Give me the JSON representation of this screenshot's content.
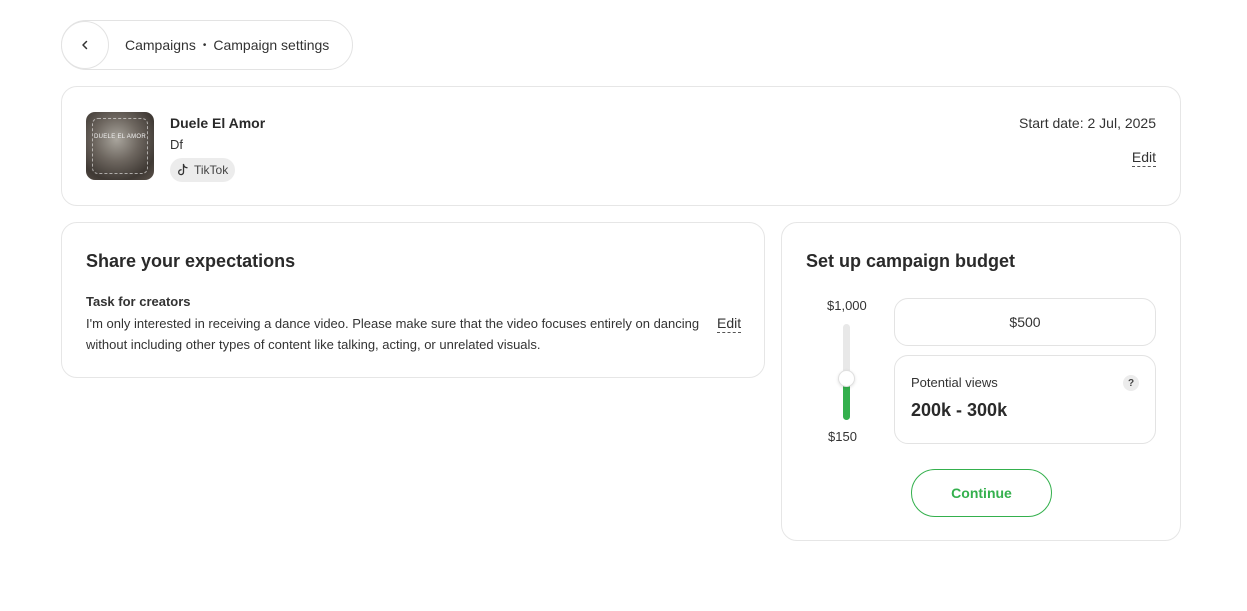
{
  "breadcrumb": {
    "items": [
      "Campaigns",
      "Campaign settings"
    ],
    "separator": "•"
  },
  "campaign": {
    "cover_text": "DUELE EL AMOR",
    "title": "Duele El Amor",
    "subtitle": "Df",
    "platform": "TikTok",
    "platform_icon": "tiktok-icon",
    "start_date": "Start date: 2 Jul, 2025",
    "edit_label": "Edit"
  },
  "expectations": {
    "title": "Share your expectations",
    "task_label": "Task for creators",
    "task_text": "I'm only interested in receiving a dance video. Please make sure that the video focuses entirely on dancing without including other types of content like talking, acting, or unrelated visuals.",
    "edit_label": "Edit"
  },
  "budget": {
    "title": "Set up campaign budget",
    "slider_max_label": "$1,000",
    "slider_min_label": "$150",
    "slider_level": 0.43,
    "amount": "$500",
    "views_label": "Potential views",
    "views_value": "200k - 300k",
    "help_icon": "?",
    "continue_label": "Continue"
  },
  "colors": {
    "accent": "#34b04d",
    "border": "#e3e3e3",
    "text": "#2a2a2a"
  }
}
